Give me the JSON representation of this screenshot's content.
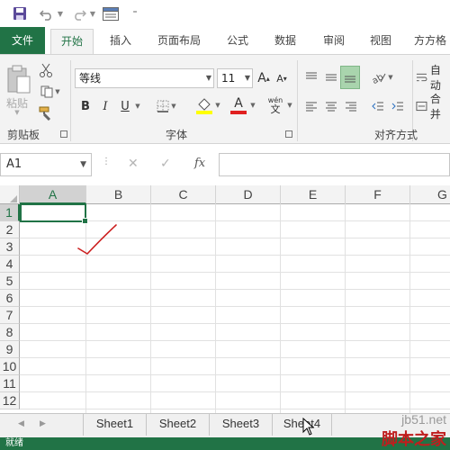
{
  "qat": {
    "save_icon": "save-icon",
    "undo_icon": "undo-icon",
    "redo_icon": "redo-icon",
    "form_icon": "form-icon"
  },
  "tabs": [
    {
      "label": "文件"
    },
    {
      "label": "开始"
    },
    {
      "label": "插入"
    },
    {
      "label": "页面布局"
    },
    {
      "label": "公式"
    },
    {
      "label": "数据"
    },
    {
      "label": "审阅"
    },
    {
      "label": "视图"
    },
    {
      "label": "方方格"
    }
  ],
  "ribbon": {
    "clipboard": {
      "paste_label": "粘贴",
      "group_label": "剪贴板"
    },
    "font": {
      "font_name": "等线",
      "font_size": "11",
      "bold": "B",
      "italic": "I",
      "underline": "U",
      "grow": "A",
      "shrink": "A",
      "font_color_glyph": "A",
      "phonetic_top": "wén",
      "phonetic_bottom": "文",
      "group_label": "字体"
    },
    "alignment": {
      "group_label": "对齐方式",
      "wrap_label": "自动",
      "merge_label": "合并"
    }
  },
  "formula_bar": {
    "name_box": "A1",
    "cancel": "✕",
    "enter": "✓",
    "fx": "fx",
    "value": ""
  },
  "grid": {
    "columns": [
      "A",
      "B",
      "C",
      "D",
      "E",
      "F",
      "G"
    ],
    "rows": [
      "1",
      "2",
      "3",
      "4",
      "5",
      "6",
      "7",
      "8",
      "9",
      "10",
      "11",
      "12"
    ],
    "selected_cell": "A1"
  },
  "sheets": [
    "Sheet1",
    "Sheet2",
    "Sheet3",
    "Sheet4"
  ],
  "status": {
    "text": "就绪"
  },
  "watermark": {
    "site": "jb51.net",
    "name": "脚本之家"
  },
  "colors": {
    "accent": "#217346",
    "check_mark": "#cc2020"
  }
}
